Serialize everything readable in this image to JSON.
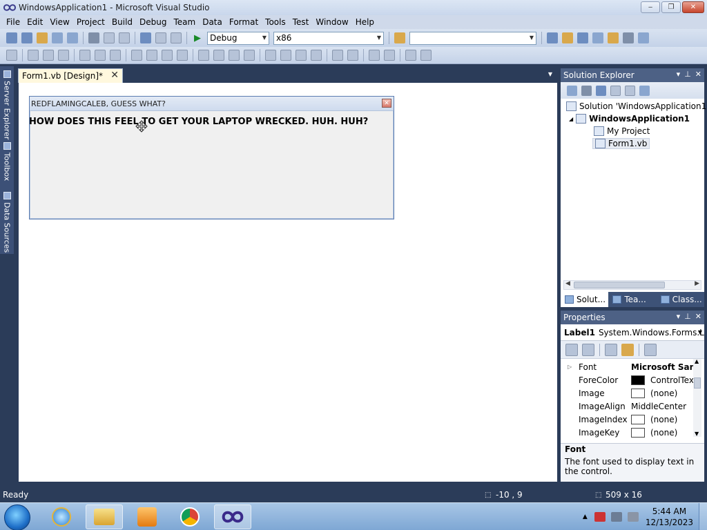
{
  "window": {
    "title": "WindowsApplication1 - Microsoft Visual Studio",
    "min": "‒",
    "max": "❐",
    "close": "✕"
  },
  "menu": [
    "File",
    "Edit",
    "View",
    "Project",
    "Build",
    "Debug",
    "Team",
    "Data",
    "Format",
    "Tools",
    "Test",
    "Window",
    "Help"
  ],
  "toolbar": {
    "config": "Debug",
    "platform": "x86",
    "find_value": ""
  },
  "side_tabs": [
    "Server Explorer",
    "Toolbox",
    "Data Sources"
  ],
  "document_tab": {
    "label": "Form1.vb [Design]*",
    "close": "✕"
  },
  "form": {
    "title": "REDFLAMINGCALEB, GUESS WHAT?",
    "label_text": "HOW DOES THIS FEEL TO GET YOUR LAPTOP WRECKED. HUH. HUH?"
  },
  "solution_explorer": {
    "title": "Solution Explorer",
    "tree": [
      {
        "label": "Solution 'WindowsApplication1'"
      },
      {
        "label": "WindowsApplication1"
      },
      {
        "label": "My Project"
      },
      {
        "label": "Form1.vb"
      }
    ],
    "bottom_tabs": [
      "Solut...",
      "Tea...",
      "Class..."
    ]
  },
  "properties": {
    "title": "Properties",
    "object": "Label1",
    "object_type": "System.Windows.Forms.La",
    "rows": [
      {
        "name": "Font",
        "value": "Microsoft Sans",
        "bold": true,
        "swatch": ""
      },
      {
        "name": "ForeColor",
        "value": "ControlTex",
        "swatch": "#000000"
      },
      {
        "name": "Image",
        "value": "(none)",
        "swatch": "#ffffff"
      },
      {
        "name": "ImageAlign",
        "value": "MiddleCenter",
        "swatch": ""
      },
      {
        "name": "ImageIndex",
        "value": "(none)",
        "swatch": "#ffffff"
      },
      {
        "name": "ImageKey",
        "value": "(none)",
        "swatch": "#ffffff"
      }
    ],
    "desc_title": "Font",
    "desc_text": "The font used to display text in the control."
  },
  "status": {
    "text": "Ready",
    "position": "-10 , 9",
    "size": "509 x 16"
  },
  "clock": {
    "time": "5:44 AM",
    "date": "12/13/2023"
  }
}
